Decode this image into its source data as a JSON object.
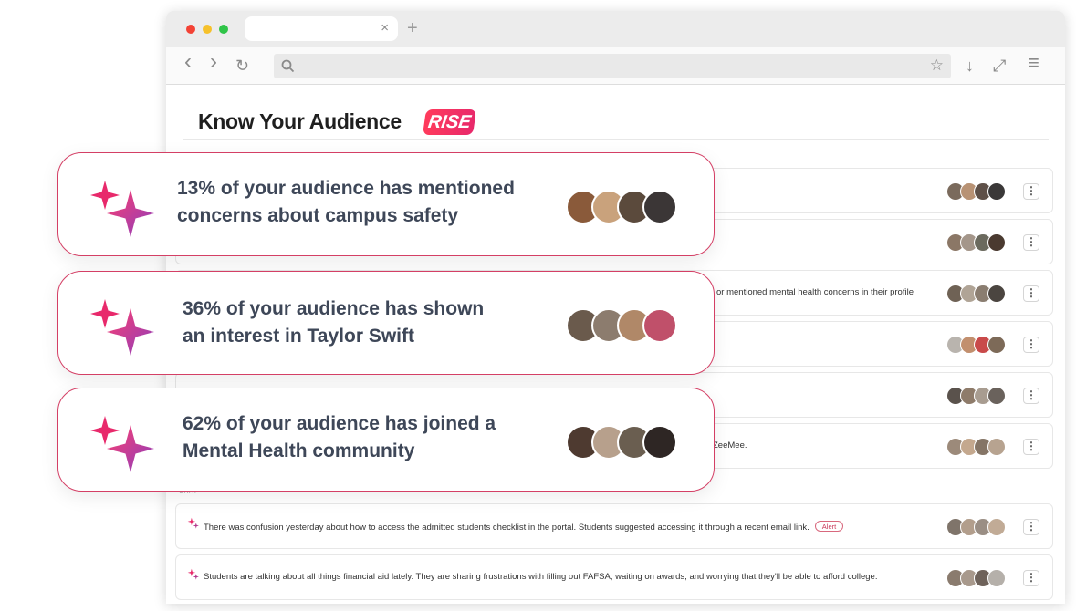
{
  "browser": {
    "tab_close": "×",
    "new_tab": "+",
    "back": "‹",
    "forward": "›",
    "reload": "↻",
    "bookmark": "☆",
    "download": "↓",
    "fullscreen": "⤢",
    "menu": "≡"
  },
  "page": {
    "title": "Know Your Audience",
    "badge": "RISE",
    "section_label": "CHAT"
  },
  "rows": [
    {
      "text": ""
    },
    {
      "text": ""
    },
    {
      "text": "or mentioned mental health concerns in their profile"
    },
    {
      "text": ""
    },
    {
      "text": ""
    },
    {
      "text": "ZeeMee."
    },
    {
      "text": "There was confusion yesterday about how to access the admitted students checklist in the portal. Students suggested accessing it through a recent email link.",
      "tag": "Alert"
    },
    {
      "text": "Students are talking about all things financial aid lately. They are sharing frustrations with filling out FAFSA, waiting on awards, and worrying that they'll be able to afford college."
    }
  ],
  "kebab_label": "⋮",
  "cards": [
    {
      "line1": "13% of your audience has mentioned",
      "line2": "concerns about campus safety"
    },
    {
      "line1": "36% of your audience has shown",
      "line2": "an interest in Taylor Swift"
    },
    {
      "line1": "62% of your audience has joined a",
      "line2": "Mental Health community"
    }
  ],
  "colors": {
    "accent": "#d43f65",
    "spark_start": "#e8296b",
    "spark_end": "#8a3fbf",
    "text_dark": "#3e4758"
  }
}
